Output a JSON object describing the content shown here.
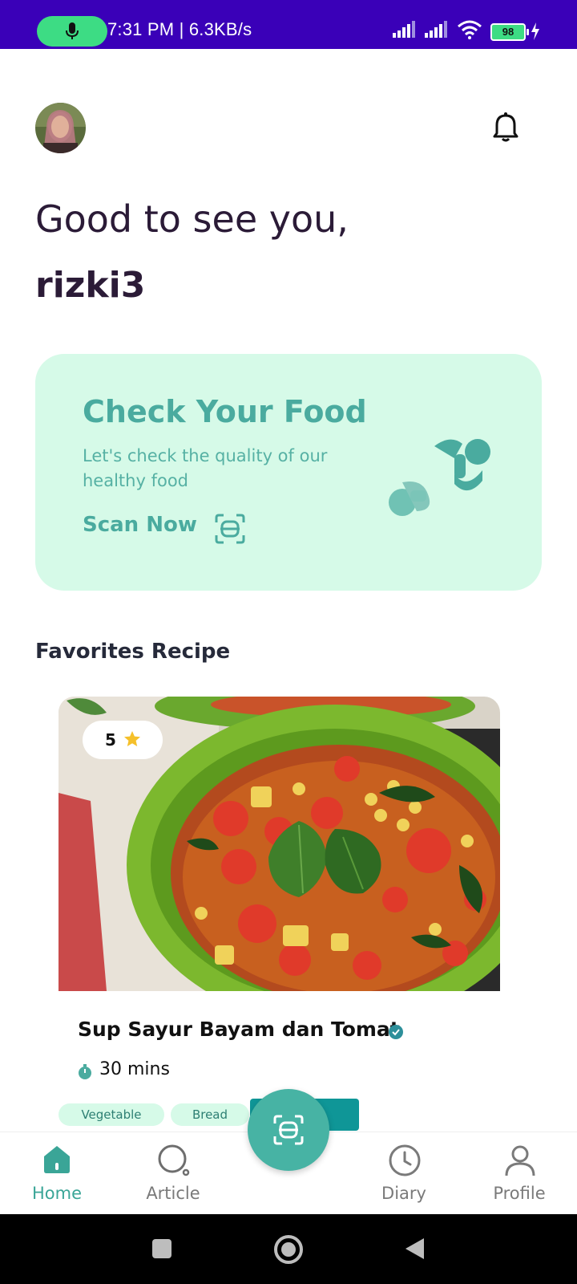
{
  "status_bar": {
    "time_speed": "7:31 PM | 6.3KB/s",
    "battery": "98",
    "icons": [
      "mic-icon",
      "signal-icon",
      "signal-icon",
      "wifi-icon",
      "battery-icon",
      "charging-icon"
    ]
  },
  "header": {
    "avatar": "avatar",
    "notification_icon": "bell-icon"
  },
  "greeting": {
    "line1": "Good to see you,",
    "username": "rizki3"
  },
  "scan_card": {
    "title": "Check Your Food",
    "subtitle": "Let's check the quality of our healthy food",
    "action_label": "Scan Now",
    "action_icon": "scan-icon",
    "colors": {
      "background": "#d6fae8",
      "accent": "#4aab9f"
    }
  },
  "favorites": {
    "section_title": "Favorites Recipe",
    "recipe": {
      "rating": "5",
      "name": "Sup Sayur Bayam dan Tomat",
      "time": "30 mins",
      "tags": [
        "Vegetable",
        "Bread"
      ]
    }
  },
  "bottom_nav": {
    "items": [
      {
        "label": "Home",
        "icon": "home-icon",
        "active": true
      },
      {
        "label": "Article",
        "icon": "search-icon",
        "active": false
      },
      {
        "label": "Diary",
        "icon": "clock-icon",
        "active": false
      },
      {
        "label": "Profile",
        "icon": "user-icon",
        "active": false
      }
    ],
    "fab_icon": "scan-icon",
    "colors": {
      "active": "#3aa597",
      "fab": "#47b3a4"
    }
  },
  "system_nav": {
    "icons": [
      "recents-icon",
      "home-circle-icon",
      "back-icon"
    ]
  }
}
